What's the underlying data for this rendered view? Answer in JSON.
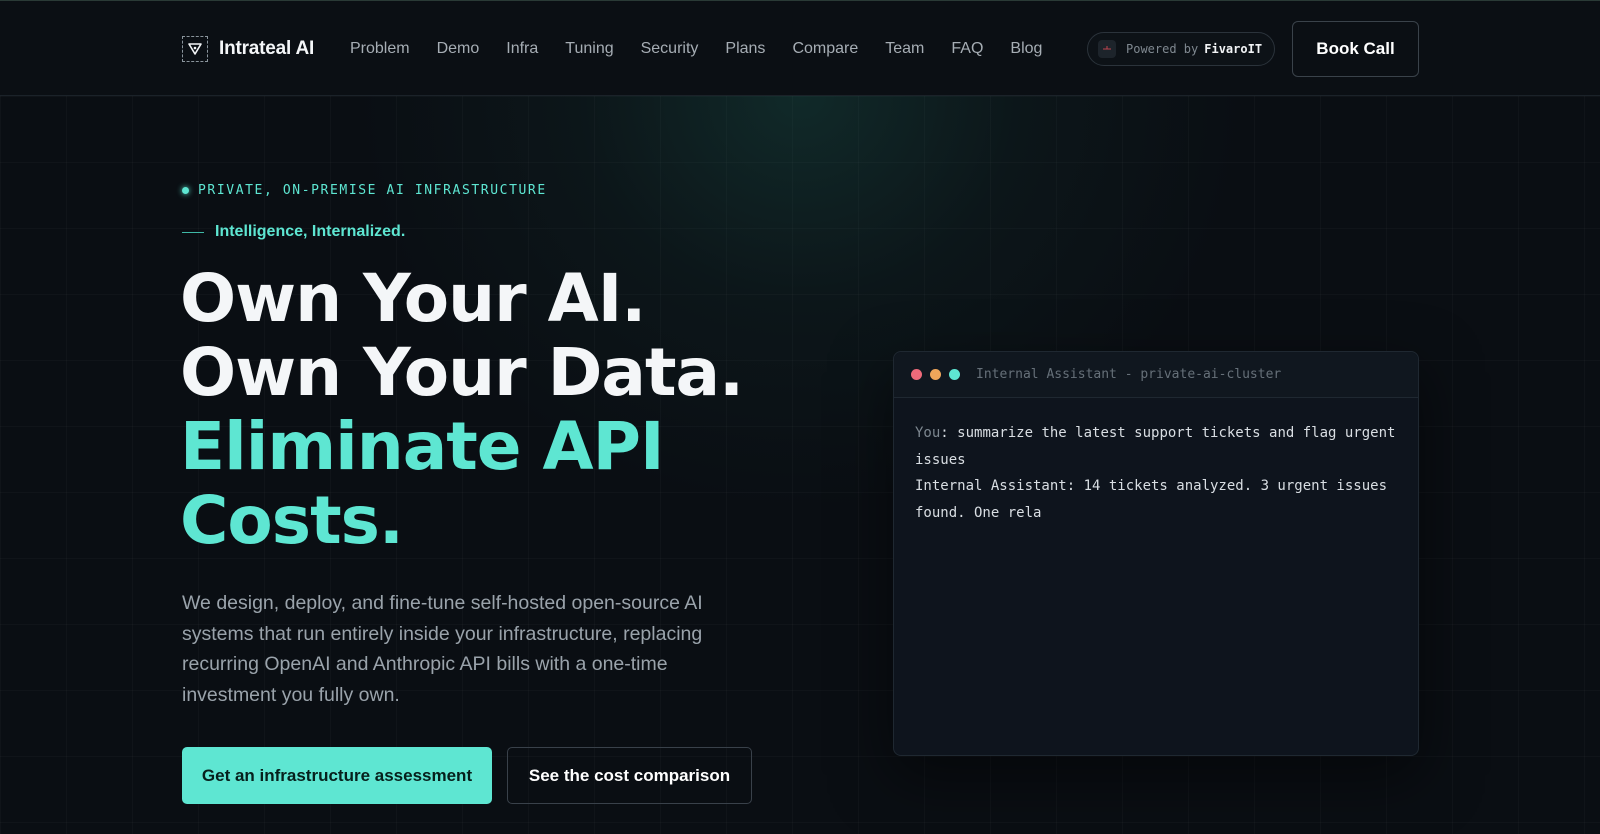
{
  "header": {
    "brand": "Intrateal AI",
    "nav": [
      "Problem",
      "Demo",
      "Infra",
      "Tuning",
      "Security",
      "Plans",
      "Compare",
      "Team",
      "FAQ",
      "Blog"
    ],
    "powered_prefix": "Powered by",
    "powered_brand": "FivaroIT",
    "book_call": "Book Call"
  },
  "hero": {
    "eyebrow": "PRIVATE, ON-PREMISE AI INFRASTRUCTURE",
    "tagline": "Intelligence, Internalized.",
    "headline": {
      "line1": "Own Your AI.",
      "line2": "Own Your Data.",
      "line3": "Eliminate API",
      "line4": "Costs."
    },
    "description": "We design, deploy, and fine-tune self-hosted open-source AI systems that run entirely inside your infrastructure, replacing recurring OpenAI and Anthropic API bills with a one-time investment you fully own.",
    "cta_primary": "Get an infrastructure assessment",
    "cta_secondary": "See the cost comparison"
  },
  "terminal": {
    "title": "Internal Assistant - private-ai-cluster",
    "user_label": "You",
    "user_message": ": summarize the latest support tickets and flag urgent issues",
    "assistant_message": "Internal Assistant: 14 tickets analyzed. 3 urgent issues found. One rela"
  },
  "colors": {
    "background": "#0a0e13",
    "accent": "#5ee6d2",
    "dot_red": "#ef6a7a",
    "dot_yellow": "#f0a65a",
    "dot_green": "#5ee6d2"
  }
}
